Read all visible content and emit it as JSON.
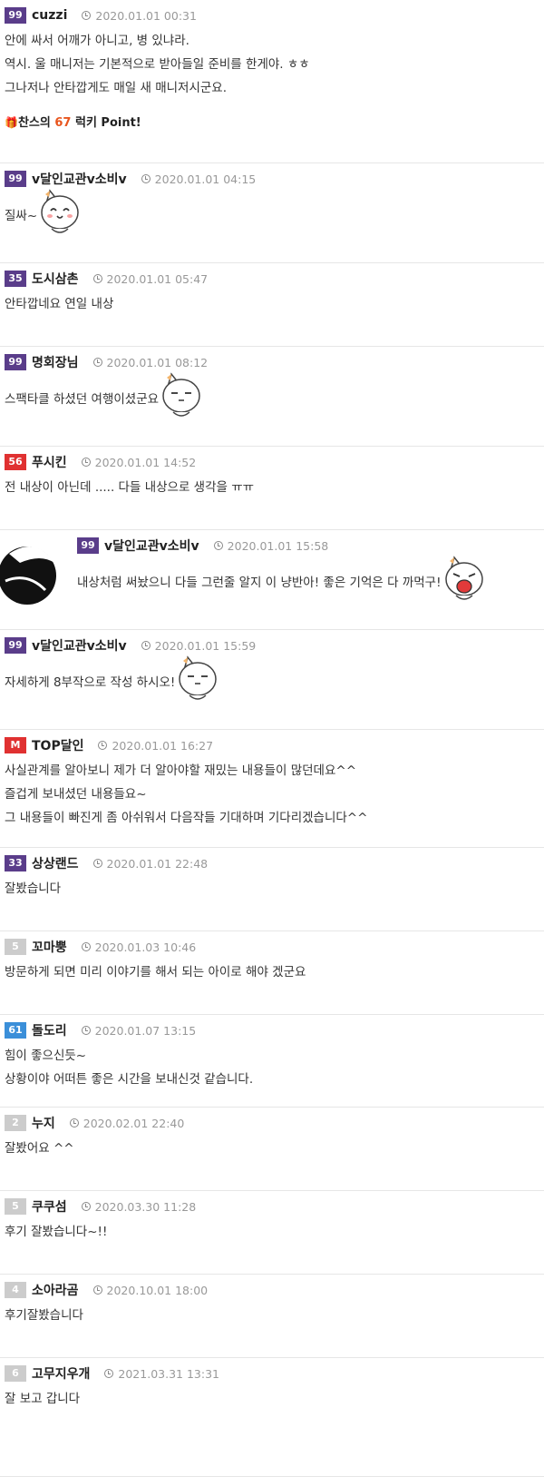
{
  "comments": [
    {
      "level": "99",
      "level_color": "#5a3d8a",
      "nick": "cuzzi",
      "date": "2020.01.01 00:31",
      "lines": [
        "안에 싸서 어깨가 아니고, 병 있냐라.",
        "역시. 울 매니저는 기본적으로 받아들일 준비를 한게야. ㅎㅎ",
        "그나저나 안타깝게도 매일 새 매니저시군요."
      ],
      "point": {
        "prefix": "찬스의 ",
        "num": "67",
        "suffix": " 럭키 Point!"
      }
    },
    {
      "level": "99",
      "level_color": "#5a3d8a",
      "nick": "v달인교관v소비v",
      "date": "2020.01.01 04:15",
      "lines": [
        "질싸~"
      ],
      "emoticon": "cat-emoticon-happy"
    },
    {
      "level": "35",
      "level_color": "#5a3d8a",
      "nick": "도시삼촌",
      "date": "2020.01.01 05:47",
      "lines": [
        "안타깝네요 연일 내상"
      ]
    },
    {
      "level": "99",
      "level_color": "#5a3d8a",
      "nick": "명회장님",
      "date": "2020.01.01 08:12",
      "lines": [
        "스팩타클 하셨던 여행이셨군요"
      ],
      "emoticon": "cat-emoticon-smug"
    },
    {
      "level": "56",
      "level_color": "#e03131",
      "nick": "푸시킨",
      "date": "2020.01.01 14:52",
      "lines": [
        "전 내상이 아닌데 ..... 다들 내상으로 생각을 ㅠㅠ"
      ]
    },
    {
      "level": "99",
      "level_color": "#5a3d8a",
      "nick": "v달인교관v소비v",
      "date": "2020.01.01 15:58",
      "lines": [
        "내상처럼 써놨으니 다들 그런줄 알지 이 냥반아! 좋은 기억은 다 까먹구!"
      ],
      "emoticon": "cat-emoticon-shout",
      "reply": true
    },
    {
      "level": "99",
      "level_color": "#5a3d8a",
      "nick": "v달인교관v소비v",
      "date": "2020.01.01 15:59",
      "lines": [
        "자세하게 8부작으로 작성 하시오!"
      ],
      "emoticon": "cat-emoticon-smug"
    },
    {
      "level": "M",
      "level_color": "#e03131",
      "nick": "TOP달인",
      "date": "2020.01.01 16:27",
      "lines": [
        "사실관계를 알아보니 제가 더 알아야할 재밌는 내용들이 많던데요^^",
        "즐겁게 보내셨던 내용들요~",
        "그 내용들이 빠진게 좀 아쉬워서 다음작들 기대하며 기다리겠습니다^^"
      ]
    },
    {
      "level": "33",
      "level_color": "#5a3d8a",
      "nick": "상상랜드",
      "date": "2020.01.01 22:48",
      "lines": [
        "잘봤습니다"
      ]
    },
    {
      "level": "5",
      "level_color": "#cccccc",
      "nick": "꼬마뿡",
      "date": "2020.01.03 10:46",
      "lines": [
        "방문하게 되면 미리 이야기를 해서 되는 아이로 해야 겠군요"
      ]
    },
    {
      "level": "61",
      "level_color": "#3b8fd9",
      "nick": "돌도리",
      "date": "2020.01.07 13:15",
      "lines": [
        "힘이 좋으신듯~",
        "상황이야 어떠튼 좋은 시간을 보내신것 같습니다."
      ]
    },
    {
      "level": "2",
      "level_color": "#cccccc",
      "nick": "누지",
      "date": "2020.02.01 22:40",
      "lines": [
        "잘봤어요 ^^"
      ]
    },
    {
      "level": "5",
      "level_color": "#cccccc",
      "nick": "쿠쿠섬",
      "date": "2020.03.30 11:28",
      "lines": [
        "후기 잘봤습니다~!!"
      ]
    },
    {
      "level": "4",
      "level_color": "#cccccc",
      "nick": "소아라곰",
      "date": "2020.10.01 18:00",
      "lines": [
        "후기잘봤습니다"
      ]
    },
    {
      "level": "6",
      "level_color": "#cccccc",
      "nick": "고무지우개",
      "date": "2021.03.31 13:31",
      "lines": [
        "잘 보고 갑니다"
      ]
    }
  ]
}
